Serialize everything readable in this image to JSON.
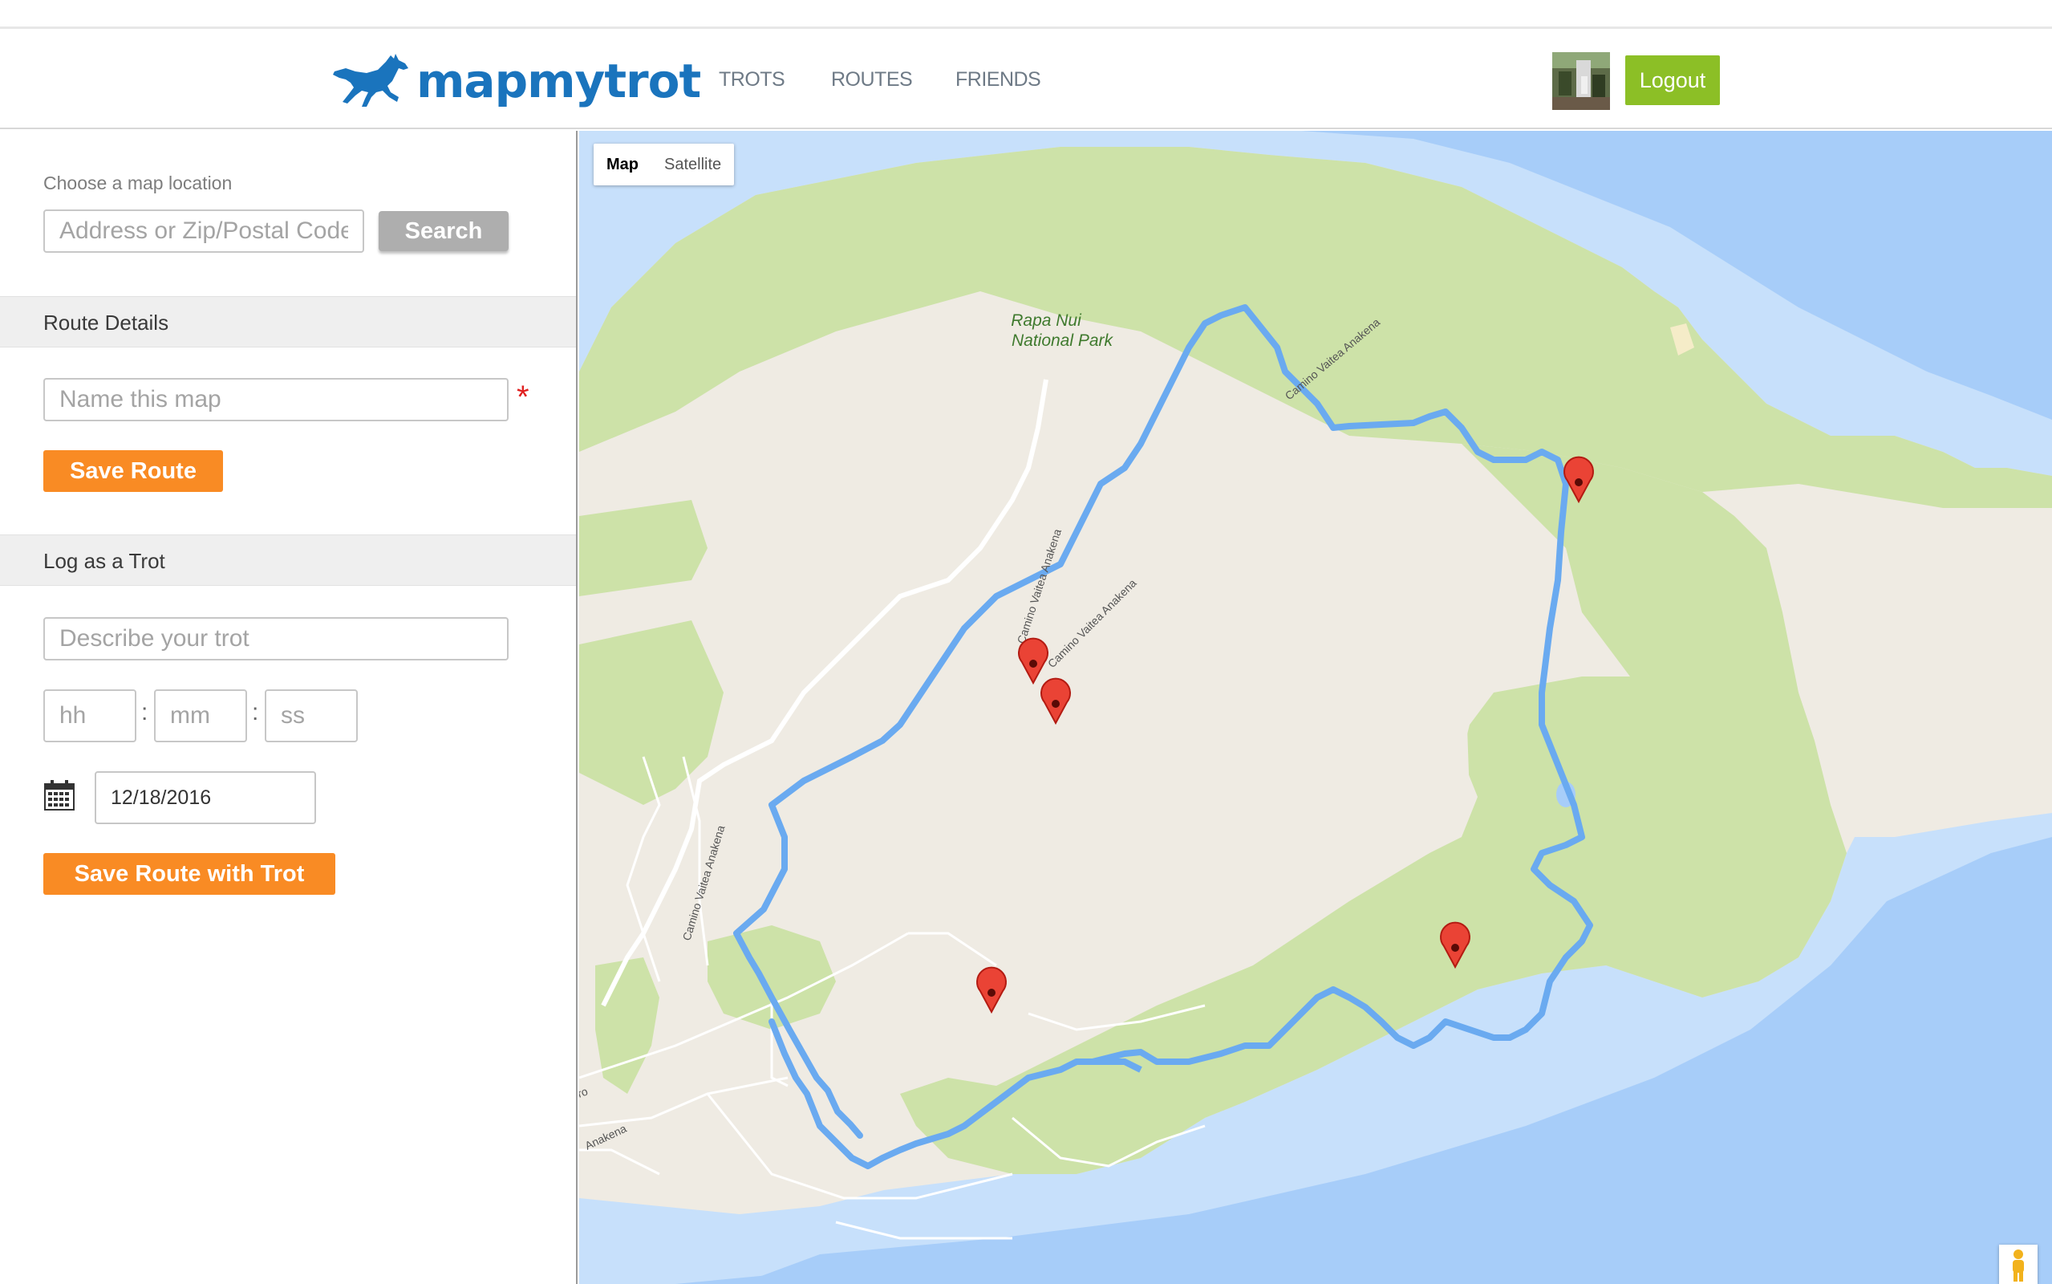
{
  "header": {
    "logo_text": "mapmytrot",
    "nav": [
      "TROTS",
      "ROUTES",
      "FRIENDS"
    ],
    "logout_label": "Logout"
  },
  "sidebar": {
    "location": {
      "label": "Choose a map location",
      "placeholder": "Address or Zip/Postal Code",
      "search_label": "Search"
    },
    "route_details": {
      "title": "Route Details",
      "name_placeholder": "Name this map",
      "required_mark": "*",
      "save_label": "Save Route"
    },
    "log_trot": {
      "title": "Log as a Trot",
      "describe_placeholder": "Describe your trot",
      "hh_placeholder": "hh",
      "mm_placeholder": "mm",
      "ss_placeholder": "ss",
      "separator": ":",
      "date_value": "12/18/2016",
      "save_label": "Save Route with Trot"
    }
  },
  "map": {
    "type_map": "Map",
    "type_satellite": "Satellite",
    "park_label_1": "Rapa Nui",
    "park_label_2": "National Park",
    "road_label_1": "Camino Vaitea Anakena",
    "road_label_2": "Camino Vaitea Anakena",
    "road_label_3": "Camino Vaitea Anakena",
    "road_label_4": "Camino Vaitea Anakena",
    "road_label_5": "Anakena",
    "road_label_6": "ro",
    "route_color": "#6aaaf0",
    "marker_color": "#ea4335",
    "water_color": "#a7cdf9"
  }
}
